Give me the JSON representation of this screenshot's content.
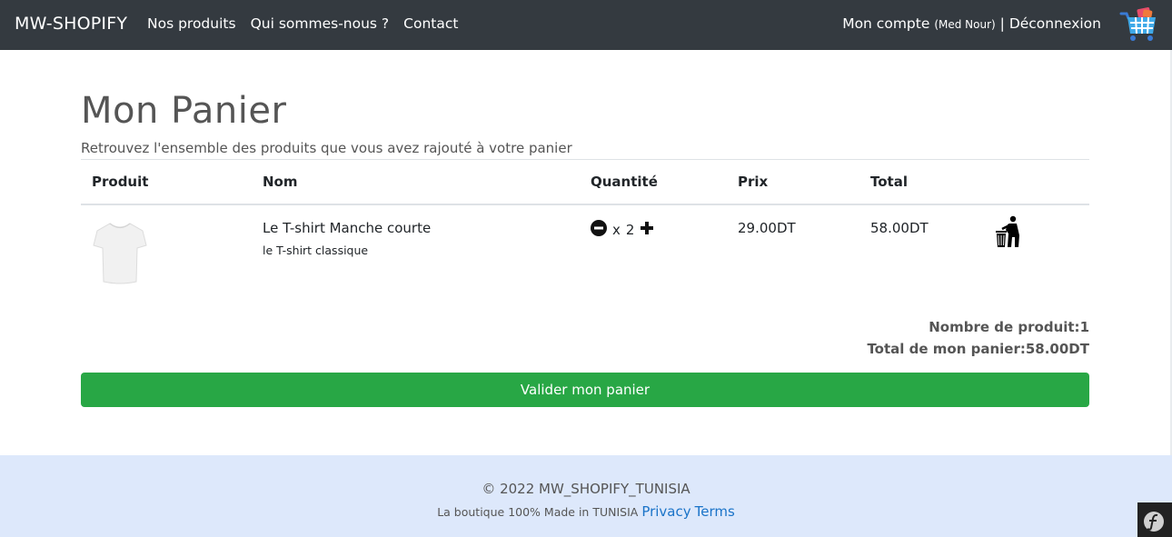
{
  "navbar": {
    "brand": "MW-SHOPIFY",
    "links": [
      "Nos produits",
      "Qui sommes-nous ?",
      "Contact"
    ],
    "account_label": "Mon compte",
    "account_user": "(Med Nour)",
    "separator": "|",
    "logout_label": "Déconnexion",
    "cart_icon": "shopping-cart-icon"
  },
  "page": {
    "title": "Mon Panier",
    "subtitle": "Retrouvez l'ensemble des produits que vous avez rajouté à votre panier"
  },
  "table": {
    "headers": [
      "Produit",
      "Nom",
      "Quantité",
      "Prix",
      "Total"
    ],
    "rows": [
      {
        "image_icon": "tshirt-image",
        "name": "Le T-shirt Manche courte",
        "description": "le T-shirt classique",
        "quantity_prefix": "x",
        "quantity": "2",
        "price": "29.00DT",
        "total": "58.00DT",
        "delete_icon": "trash-icon"
      }
    ]
  },
  "summary": {
    "count_label": "Nombre de produit:",
    "count_value": "1",
    "total_label": "Total de mon panier:",
    "total_value": "58.00DT"
  },
  "validate_label": "Valider mon panier",
  "footer": {
    "copyright": "© 2022 MW_SHOPIFY_TUNISIA",
    "tagline": "La boutique 100% Made in TUNISIA",
    "privacy": "Privacy",
    "terms": "Terms"
  },
  "colors": {
    "navbar": "#343a40",
    "button": "#28a745",
    "footer": "#dde8fb",
    "link": "#1a73c8"
  }
}
